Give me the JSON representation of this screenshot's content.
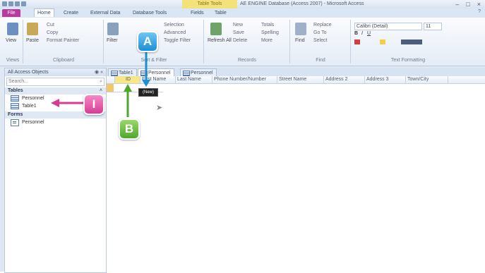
{
  "window": {
    "title": "AE ENGINE Database (Access 2007) - Microsoft Access",
    "context_tab": "Table Tools"
  },
  "ribbon_tabs": [
    "File",
    "Home",
    "Create",
    "External Data",
    "Database Tools",
    "Fields",
    "Table"
  ],
  "ribbon_groups": [
    "Views",
    "Clipboard",
    "Sort & Filter",
    "Records",
    "Find",
    "Text Formatting"
  ],
  "ribbon_buttons": {
    "view": "View",
    "paste": "Paste",
    "cut": "Cut",
    "copy": "Copy",
    "format_painter": "Format Painter",
    "filter": "Filter",
    "selection": "Selection",
    "advanced": "Advanced",
    "toggle_filter": "Toggle Filter",
    "refresh_all": "Refresh All",
    "new": "New",
    "save": "Save",
    "delete": "Delete",
    "totals": "Totals",
    "spelling": "Spelling",
    "more": "More",
    "find": "Find",
    "replace": "Replace",
    "go_to": "Go To",
    "select": "Select",
    "font": "Calibri (Detail)",
    "font_size": "11"
  },
  "nav": {
    "header": "All Access Objects",
    "search_placeholder": "Search...",
    "sections": [
      {
        "name": "Tables",
        "items": [
          "Personnel",
          "Table1"
        ]
      },
      {
        "name": "Forms",
        "items": [
          "Personnel"
        ]
      }
    ]
  },
  "doc_tabs": [
    "Table1",
    "Personnel",
    "Personnel"
  ],
  "columns": [
    "ID",
    "First Name",
    "Last Name",
    "Phone Number/Number",
    "Street Name",
    "Address 2",
    "Address 3",
    "Town/City"
  ],
  "tooltip": "(New)",
  "callouts": {
    "a": "A",
    "b": "B",
    "i": "I"
  },
  "colors": {
    "file_tab": "#b83a9e",
    "callout_a": "#1c8fd6",
    "callout_b": "#4fa82c",
    "callout_i": "#d83a93"
  }
}
